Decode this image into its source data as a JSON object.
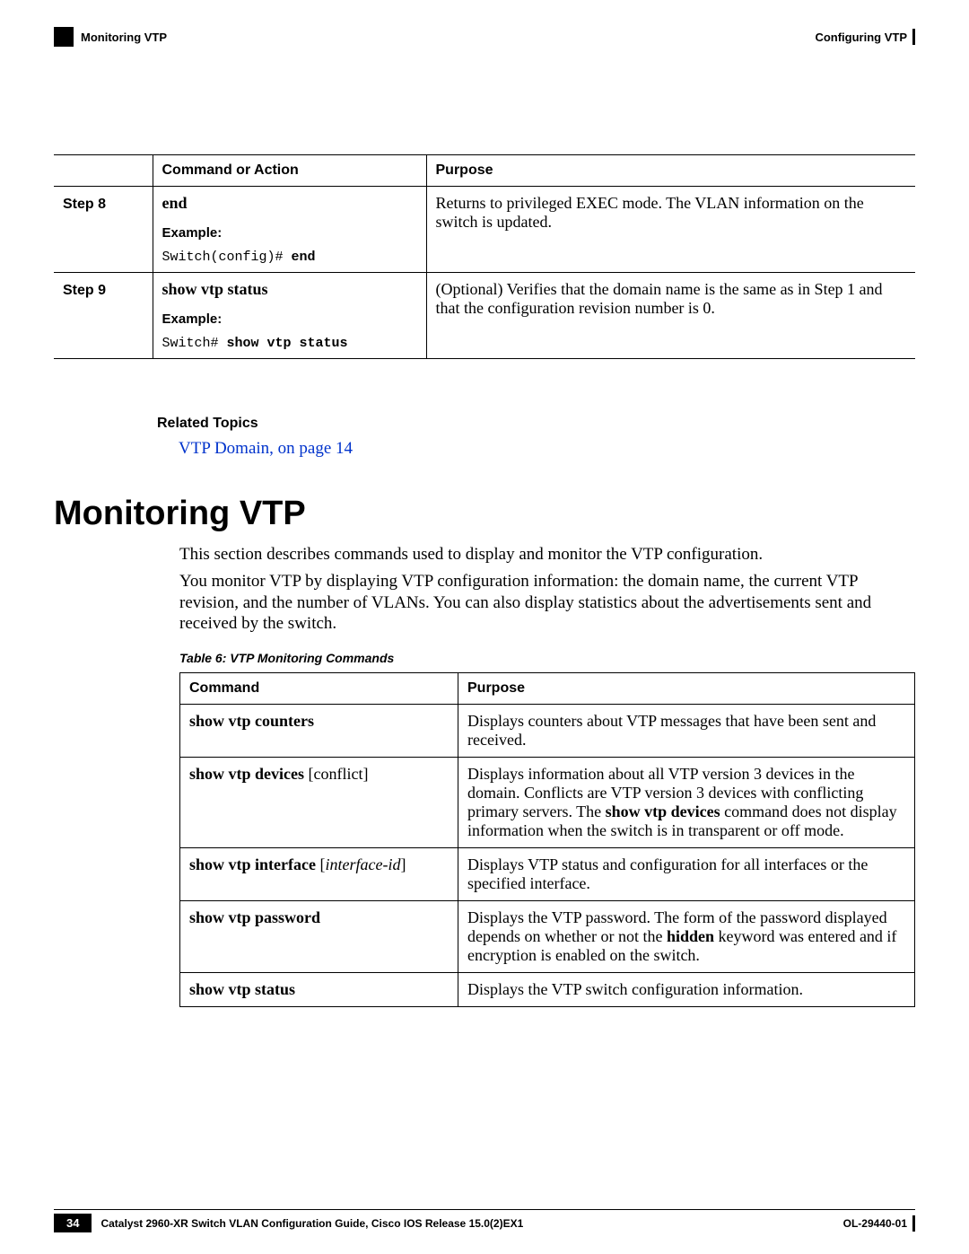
{
  "header": {
    "left_label": "Monitoring VTP",
    "right_label": "Configuring VTP"
  },
  "steps_table": {
    "headers": {
      "step": "",
      "cmd": "Command or Action",
      "purpose": "Purpose"
    },
    "rows": [
      {
        "step": "Step 8",
        "cmd_bold": "end",
        "example_label": "Example:",
        "code_prefix": "Switch(config)# ",
        "code_bold": "end",
        "purpose": "Returns to privileged EXEC mode. The VLAN information on the switch is updated."
      },
      {
        "step": "Step 9",
        "cmd_bold": "show vtp status",
        "example_label": "Example:",
        "code_prefix": "Switch# ",
        "code_bold": "show vtp status",
        "purpose": "(Optional) Verifies that the domain name is the same as in Step 1 and that the configuration revision number is 0."
      }
    ]
  },
  "related": {
    "title": "Related Topics",
    "link": "VTP Domain,  on page 14"
  },
  "section": {
    "heading": "Monitoring VTP",
    "p1": "This section describes commands used to display and monitor the VTP configuration.",
    "p2": "You monitor VTP by displaying VTP configuration information: the domain name, the current VTP revision, and the number of VLANs. You can also display statistics about the advertisements sent and received by the switch.",
    "table_caption": "Table 6: VTP Monitoring Commands"
  },
  "monitor_table": {
    "headers": {
      "cmd": "Command",
      "purpose": "Purpose"
    },
    "rows": [
      {
        "cmd_bold": "show vtp counters",
        "cmd_ital": "",
        "cmd_after": "",
        "purpose_pre": "Displays counters about VTP messages that have been sent and received.",
        "purpose_bold": "",
        "purpose_post": ""
      },
      {
        "cmd_bold": "show vtp devices ",
        "cmd_ital": "",
        "cmd_after": "[conflict]",
        "purpose_pre": "Displays information about all VTP version 3 devices in the domain. Conflicts are VTP version 3 devices with conflicting primary servers. The ",
        "purpose_bold": "show vtp devices",
        "purpose_post": " command does not display information when the switch is in transparent or off mode."
      },
      {
        "cmd_bold": "show vtp interface ",
        "cmd_ital": "interface-id",
        "cmd_after": "",
        "purpose_pre": "Displays VTP status and configuration for all interfaces or the specified interface.",
        "purpose_bold": "",
        "purpose_post": ""
      },
      {
        "cmd_bold": "show vtp password",
        "cmd_ital": "",
        "cmd_after": "",
        "purpose_pre": "Displays the VTP password. The form of the password displayed depends on whether or not the ",
        "purpose_bold": "hidden",
        "purpose_post": " keyword was entered and if encryption is enabled on the switch."
      },
      {
        "cmd_bold": "show vtp status",
        "cmd_ital": "",
        "cmd_after": "",
        "purpose_pre": "Displays the VTP switch configuration information.",
        "purpose_bold": "",
        "purpose_post": ""
      }
    ]
  },
  "footer": {
    "page": "34",
    "guide": "Catalyst 2960-XR Switch VLAN Configuration Guide, Cisco IOS Release 15.0(2)EX1",
    "doc_id": "OL-29440-01"
  }
}
